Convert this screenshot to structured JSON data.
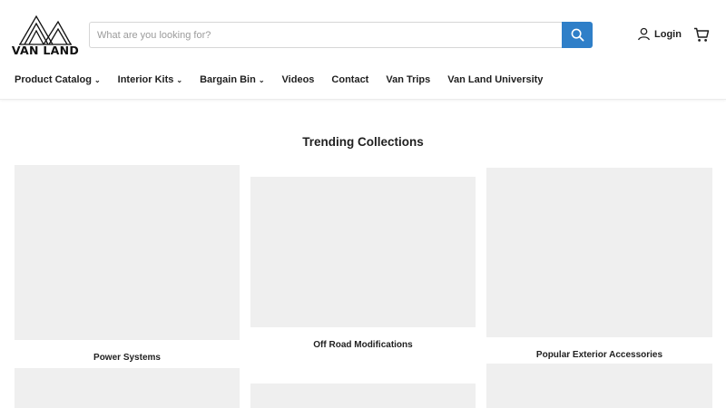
{
  "brand": {
    "name": "VAN LAND"
  },
  "search": {
    "placeholder": "What are you looking for?",
    "value": ""
  },
  "account": {
    "login_label": "Login"
  },
  "nav": {
    "items": [
      {
        "label": "Product Catalog",
        "has_dropdown": true
      },
      {
        "label": "Interior Kits",
        "has_dropdown": true
      },
      {
        "label": "Bargain Bin",
        "has_dropdown": true
      },
      {
        "label": "Videos",
        "has_dropdown": false
      },
      {
        "label": "Contact",
        "has_dropdown": false
      },
      {
        "label": "Van Trips",
        "has_dropdown": false
      },
      {
        "label": "Van Land University",
        "has_dropdown": false
      }
    ]
  },
  "trending": {
    "title": "Trending Collections",
    "collections": [
      {
        "label": "Power Systems"
      },
      {
        "label": "Off Road Modifications"
      },
      {
        "label": "Popular Exterior Accessories"
      }
    ]
  },
  "colors": {
    "accent": "#2f7fc8",
    "placeholder_gray": "#efefef",
    "text": "#1f1f1f"
  },
  "icons": {
    "search": "search-icon",
    "user": "user-icon",
    "cart": "cart-icon",
    "chevron": "chevron-down-icon"
  }
}
